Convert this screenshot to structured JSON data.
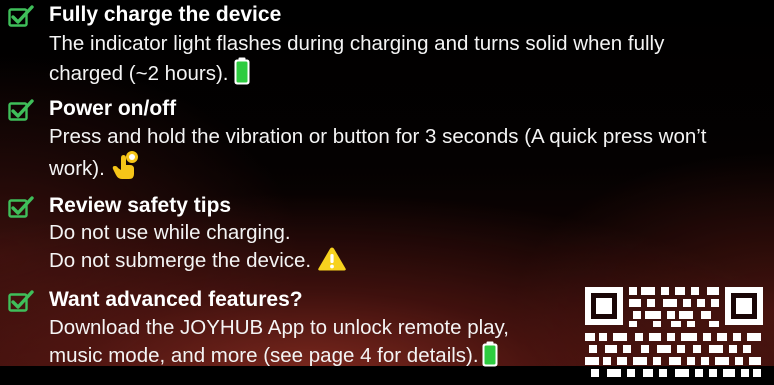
{
  "steps": [
    {
      "title": "Fully charge the device",
      "lines": [
        "The indicator light flashes during charging and turns solid when fully",
        "charged (~2 hours)."
      ],
      "icon": "battery-icon"
    },
    {
      "title": "Power on/off",
      "lines": [
        "Press and hold the vibration or button for 3 seconds (A quick press won’t",
        "work)."
      ],
      "icon": "hand-press-icon"
    },
    {
      "title": "Review safety tips",
      "lines": [
        "Do not use while charging.",
        "Do not submerge the device."
      ],
      "icon": "warning-icon"
    },
    {
      "title": "Want advanced features?",
      "lines": [
        "Download the JOYHUB App to unlock remote play,",
        "music mode, and more (see page 4 for details)."
      ],
      "icon": "battery-icon"
    }
  ],
  "colors": {
    "check_green": "#3fbf5a",
    "battery_green": "#2ecc40",
    "hand_yellow": "#f5c518",
    "warning_yellow": "#f7d21e"
  },
  "qr_code": "qr-code-icon"
}
